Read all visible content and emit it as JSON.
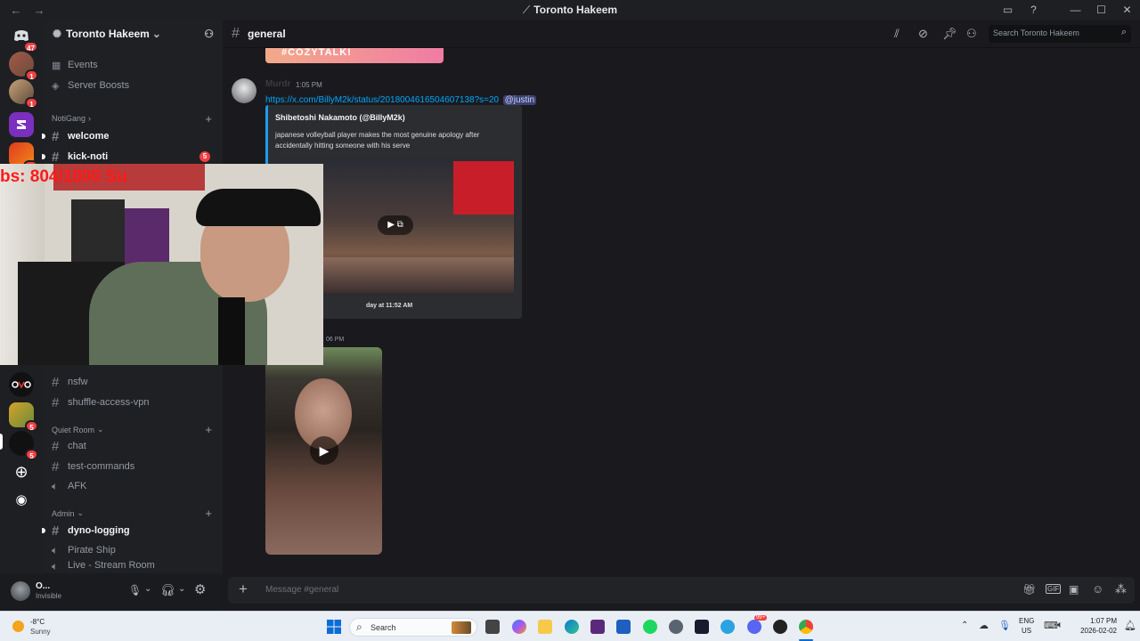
{
  "titlebar": {
    "back": "←",
    "forward": "→",
    "title": "Toronto Hakeem"
  },
  "rail": {
    "dm_badge": "47",
    "badges": [
      "1",
      "1",
      "19",
      "5",
      "5"
    ]
  },
  "guild": {
    "name": "Toronto Hakeem"
  },
  "sidebar": {
    "events": "Events",
    "boosts": "Server Boosts",
    "cat_notigang": "NotiGang",
    "welcome": "welcome",
    "kick_noti": "kick-noti",
    "kick_badge": "5",
    "nsfw": "nsfw",
    "shuffle": "shuffle-access-vpn",
    "cat_quiet": "Quiet Room",
    "chat": "chat",
    "test_commands": "test-commands",
    "afk": "AFK",
    "cat_admin": "Admin",
    "dyno": "dyno-logging",
    "pirate": "Pirate Ship",
    "live": "Live - Stream Room"
  },
  "user": {
    "name": "O...",
    "status": "Invisible"
  },
  "header": {
    "channel": "general",
    "search_placeholder": "Search Toronto Hakeem"
  },
  "messages": {
    "top_image_text": "#COZYTALK!",
    "author": "Murdr",
    "time1": "1:05 PM",
    "url": "https://x.com/BillyM2k/status/2018004616504607138?s=20",
    "mention": "@justin",
    "embed_author": "Shibetoshi Nakamoto (@BillyM2k)",
    "embed_text": "japanese volleyball player makes the most genuine apology after accidentally hitting someone with his serve",
    "embed_footer": "day at 11:52 AM",
    "time2": "06 PM"
  },
  "composer": {
    "placeholder": "Message #general"
  },
  "overlay": {
    "text": "bs: 804/1000  Su"
  },
  "taskbar": {
    "temp": "-8°C",
    "weather": "Sunny",
    "search": "Search",
    "lang": "ENG",
    "region": "US",
    "time": "1:07 PM",
    "date": "2026-02-02",
    "discord_badge": "99+"
  }
}
